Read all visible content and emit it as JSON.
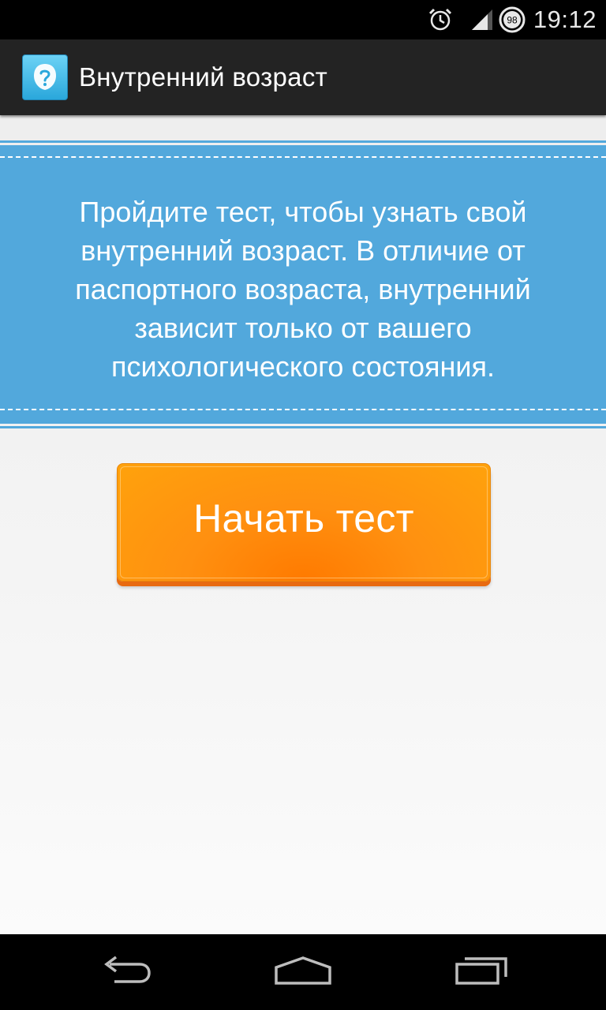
{
  "status_bar": {
    "time": "19:12",
    "battery_level": "98",
    "icons": [
      "alarm-icon",
      "signal-icon",
      "battery-icon"
    ]
  },
  "action_bar": {
    "title": "Внутренний возраст",
    "icon": "app-face-question-icon"
  },
  "banner": {
    "text": "Пройдите тест, чтобы узнать свой внутренний возраст. В отличие от паспортного возраста, внутренний зависит только от вашего психологического состояния."
  },
  "start_button": {
    "label": "Начать тест"
  },
  "nav_bar": {
    "icons": [
      "back-icon",
      "home-icon",
      "recents-icon"
    ]
  },
  "colors": {
    "banner": "#52a8dc",
    "button": "#ff9010",
    "action_bar": "#232323"
  }
}
